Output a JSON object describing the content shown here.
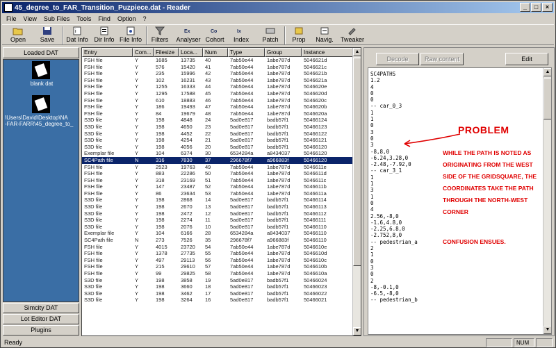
{
  "window": {
    "title": "45_degree_to_FAR_Transition_Puzpiece.dat - Reader"
  },
  "menu": [
    "File",
    "View",
    "Sub Files",
    "Tools",
    "Find",
    "Option",
    "?"
  ],
  "toolbar": [
    {
      "label": "Open",
      "icon": "open-folder-icon"
    },
    {
      "label": "Save",
      "icon": "save-disk-icon"
    },
    {
      "label": "Dat Info",
      "icon": "dat-info-icon"
    },
    {
      "label": "Dir Info",
      "icon": "dir-info-icon"
    },
    {
      "label": "File Info",
      "icon": "file-info-icon"
    },
    {
      "label": "Filters",
      "icon": "filter-icon"
    },
    {
      "label": "Analyser",
      "icon": "analyser-icon"
    },
    {
      "label": "Cohort",
      "icon": "cohort-icon"
    },
    {
      "label": "Index",
      "icon": "index-icon"
    },
    {
      "label": "Patch",
      "icon": "patch-icon"
    },
    {
      "label": "Prop",
      "icon": "prop-icon"
    },
    {
      "label": "Navig.",
      "icon": "navigator-icon"
    },
    {
      "label": "Tweaker",
      "icon": "tweaker-icon"
    }
  ],
  "left": {
    "header": "Loaded DAT",
    "items": [
      {
        "label": "blank dat"
      },
      {
        "label": "\\Users\\David\\Desktop\\NA\n-FAR-FARR\\45_degree_to_"
      }
    ],
    "buttons": [
      "Simcity DAT",
      "Lot Editor DAT",
      "Plugins"
    ]
  },
  "table": {
    "columns": [
      "Entry",
      "Com...",
      "Filesize",
      "Loca...",
      "Num",
      "Type",
      "Group",
      "Instance"
    ],
    "rows": [
      [
        "FSH file",
        "Y",
        "1685",
        "13735",
        "40",
        "7ab50e44",
        "1abe787d",
        "5046621d"
      ],
      [
        "FSH file",
        "Y",
        "576",
        "15420",
        "41",
        "7ab50e44",
        "1abe787d",
        "5046621c"
      ],
      [
        "FSH file",
        "Y",
        "235",
        "15996",
        "42",
        "7ab50e44",
        "1abe787d",
        "5046621b"
      ],
      [
        "FSH file",
        "Y",
        "102",
        "16231",
        "43",
        "7ab50e44",
        "1abe787d",
        "5046621a"
      ],
      [
        "FSH file",
        "Y",
        "1255",
        "16333",
        "44",
        "7ab50e44",
        "1abe787d",
        "5046620e"
      ],
      [
        "FSH file",
        "Y",
        "1295",
        "17588",
        "45",
        "7ab50e44",
        "1abe787d",
        "5046620d"
      ],
      [
        "FSH file",
        "Y",
        "610",
        "18883",
        "46",
        "7ab50e44",
        "1abe787d",
        "5046620c"
      ],
      [
        "FSH file",
        "Y",
        "186",
        "19493",
        "47",
        "7ab50e44",
        "1abe787d",
        "5046620b"
      ],
      [
        "FSH file",
        "Y",
        "84",
        "19679",
        "48",
        "7ab50e44",
        "1abe787d",
        "5046620a"
      ],
      [
        "S3D file",
        "Y",
        "198",
        "4848",
        "24",
        "5ad0e817",
        "badb57f1",
        "50466124"
      ],
      [
        "S3D file",
        "Y",
        "198",
        "4650",
        "23",
        "5ad0e817",
        "badb57f1",
        "50466123"
      ],
      [
        "S3D file",
        "Y",
        "198",
        "4452",
        "22",
        "5ad0e817",
        "badb57f1",
        "50466122"
      ],
      [
        "S3D file",
        "Y",
        "198",
        "4254",
        "21",
        "5ad0e817",
        "badb57f1",
        "50466121"
      ],
      [
        "S3D file",
        "Y",
        "198",
        "4056",
        "20",
        "5ad0e817",
        "badb57f1",
        "50466120"
      ],
      [
        "Exemplar file",
        "Y",
        "104",
        "6374",
        "30",
        "6534284a",
        "a8434037",
        "50466120"
      ],
      [
        "SC4Path file",
        "N",
        "316",
        "7830",
        "37",
        "296678f7",
        "a966883f",
        "50466120"
      ],
      [
        "FSH file",
        "Y",
        "2523",
        "19763",
        "49",
        "7ab50e44",
        "1abe787d",
        "5046611e"
      ],
      [
        "FSH file",
        "Y",
        "883",
        "22286",
        "50",
        "7ab50e44",
        "1abe787d",
        "5046611d"
      ],
      [
        "FSH file",
        "Y",
        "318",
        "23169",
        "51",
        "7ab50e44",
        "1abe787d",
        "5046611c"
      ],
      [
        "FSH file",
        "Y",
        "147",
        "23487",
        "52",
        "7ab50e44",
        "1abe787d",
        "5046611b"
      ],
      [
        "FSH file",
        "Y",
        "86",
        "23634",
        "53",
        "7ab50e44",
        "1abe787d",
        "5046611a"
      ],
      [
        "S3D file",
        "Y",
        "198",
        "2868",
        "14",
        "5ad0e817",
        "badb57f1",
        "50466114"
      ],
      [
        "S3D file",
        "Y",
        "198",
        "2670",
        "13",
        "5ad0e817",
        "badb57f1",
        "50466113"
      ],
      [
        "S3D file",
        "Y",
        "198",
        "2472",
        "12",
        "5ad0e817",
        "badb57f1",
        "50466112"
      ],
      [
        "S3D file",
        "Y",
        "198",
        "2274",
        "11",
        "5ad0e817",
        "badb57f1",
        "50466111"
      ],
      [
        "S3D file",
        "Y",
        "198",
        "2076",
        "10",
        "5ad0e817",
        "badb57f1",
        "50466110"
      ],
      [
        "Exemplar file",
        "Y",
        "104",
        "6166",
        "28",
        "6534284a",
        "a8434037",
        "50466110"
      ],
      [
        "SC4Path file",
        "N",
        "273",
        "7526",
        "35",
        "296678f7",
        "a966883f",
        "50466110"
      ],
      [
        "FSH file",
        "Y",
        "4015",
        "23720",
        "54",
        "7ab50e44",
        "1abe787d",
        "5046610e"
      ],
      [
        "FSH file",
        "Y",
        "1378",
        "27735",
        "55",
        "7ab50e44",
        "1abe787d",
        "5046610d"
      ],
      [
        "FSH file",
        "Y",
        "497",
        "29113",
        "56",
        "7ab50e44",
        "1abe787d",
        "5046610c"
      ],
      [
        "FSH file",
        "Y",
        "215",
        "29610",
        "57",
        "7ab50e44",
        "1abe787d",
        "5046610b"
      ],
      [
        "FSH file",
        "Y",
        "99",
        "29825",
        "58",
        "7ab50e44",
        "1abe787d",
        "5046610a"
      ],
      [
        "S3D file",
        "Y",
        "198",
        "3858",
        "19",
        "5ad0e817",
        "badb57f1",
        "50466024"
      ],
      [
        "S3D file",
        "Y",
        "198",
        "3660",
        "18",
        "5ad0e817",
        "badb57f1",
        "50466023"
      ],
      [
        "S3D file",
        "Y",
        "198",
        "3462",
        "17",
        "5ad0e817",
        "badb57f1",
        "50466022"
      ],
      [
        "S3D file",
        "Y",
        "198",
        "3264",
        "16",
        "5ad0e817",
        "badb57f1",
        "50466021"
      ]
    ],
    "selected_row": 15
  },
  "right": {
    "decode": "Decode",
    "raw_content": "Raw content",
    "edit": "Edit",
    "text": "SC4PATHS\n1.2\n4\n0\n0\n-- car_0_3\n1\n1\n0\n3\n0\n3\n-8,8,0\n-6.24,3.28,0\n-2.48,-7.92,0\n-- car_3_1\n1\n1\n3\n1\n0\n4\n2.56,-8,0\n-1.6,4.8,0\n-2.25,6.8,0\n-2.752,8,0\n-- pedestrian_a\n2\n1\n0\n3\n0\n2\n-8,-0.1,0\n-6.5,-8,0\n-- pedestrian_b"
  },
  "annotation": {
    "title": "PROBLEM",
    "body": "While the path is noted as originating from the west side of the gridsquare, the coordinates take the path through the north-west corner",
    "footer": "Confusion ensues.",
    "color": "#e00000"
  },
  "status": {
    "text": "Ready",
    "num": "NUM"
  }
}
